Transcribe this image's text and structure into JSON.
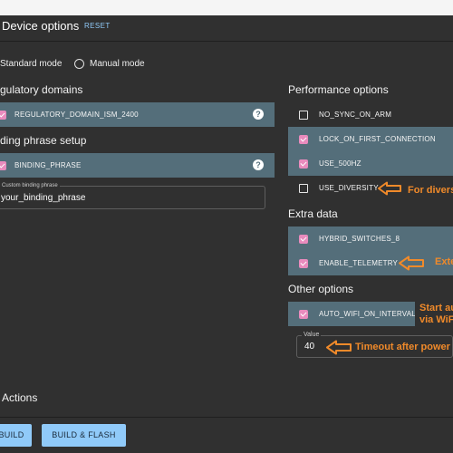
{
  "header": {
    "title": "Device options",
    "reset": "RESET"
  },
  "mode": {
    "standard": "Standard mode",
    "manual": "Manual mode"
  },
  "regulatory": {
    "title": "gulatory domains",
    "option": {
      "label": "REGULATORY_DOMAIN_ISM_2400",
      "checked": true,
      "help_icon": "help-icon"
    }
  },
  "binding": {
    "title": "ding phrase setup",
    "option": {
      "label": "BINDING_PHRASE",
      "checked": true,
      "help_icon": "help-icon"
    },
    "field": {
      "label": "Custom binding phrase",
      "value": "your_binding_phrase"
    }
  },
  "performance": {
    "title": "Performance options",
    "items": [
      {
        "label": "NO_SYNC_ON_ARM",
        "checked": false
      },
      {
        "label": "LOCK_ON_FIRST_CONNECTION",
        "checked": true
      },
      {
        "label": "USE_500HZ",
        "checked": true
      },
      {
        "label": "USE_DIVERSITY",
        "checked": false
      }
    ]
  },
  "extra": {
    "title": "Extra data",
    "items": [
      {
        "label": "HYBRID_SWITCHES_8",
        "checked": true
      },
      {
        "label": "ENABLE_TELEMETRY",
        "checked": true
      }
    ]
  },
  "other": {
    "title": "Other options",
    "items": [
      {
        "label": "AUTO_WIFI_ON_INTERVAL",
        "checked": true
      }
    ],
    "value_field": {
      "label": "Value",
      "value": "40"
    }
  },
  "annotations": {
    "diversity": "For divers",
    "telemetry": "Exte",
    "wifi_line1": "Start au",
    "wifi_line2": "via WiFi",
    "timeout": "Timeout after power"
  },
  "actions": {
    "title": "Actions",
    "build": "BUILD",
    "build_flash": "BUILD & FLASH"
  },
  "colors": {
    "background": "#303030",
    "option_row": "#546e7a",
    "checkbox": "#e98bbd",
    "button": "#90caf9",
    "annotation": "#f08a2a",
    "link": "#90caf9"
  }
}
